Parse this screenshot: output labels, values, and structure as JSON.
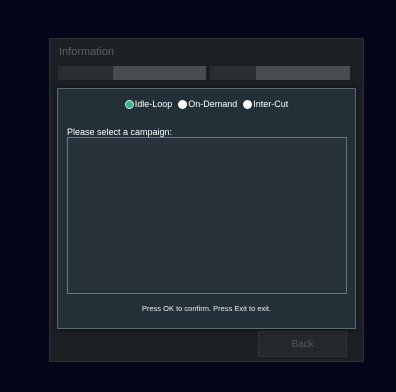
{
  "info_panel": {
    "title": "Information",
    "back_label": "Back"
  },
  "dialog": {
    "radio_options": [
      {
        "label": "Idle-Loop",
        "selected": true
      },
      {
        "label": "On-Demand",
        "selected": false
      },
      {
        "label": "Inter-Cut",
        "selected": false
      }
    ],
    "prompt": "Please select a campaign:",
    "hint": "Press OK to confirm. Press Exit to exit.",
    "accent_color": "#3bb487"
  }
}
